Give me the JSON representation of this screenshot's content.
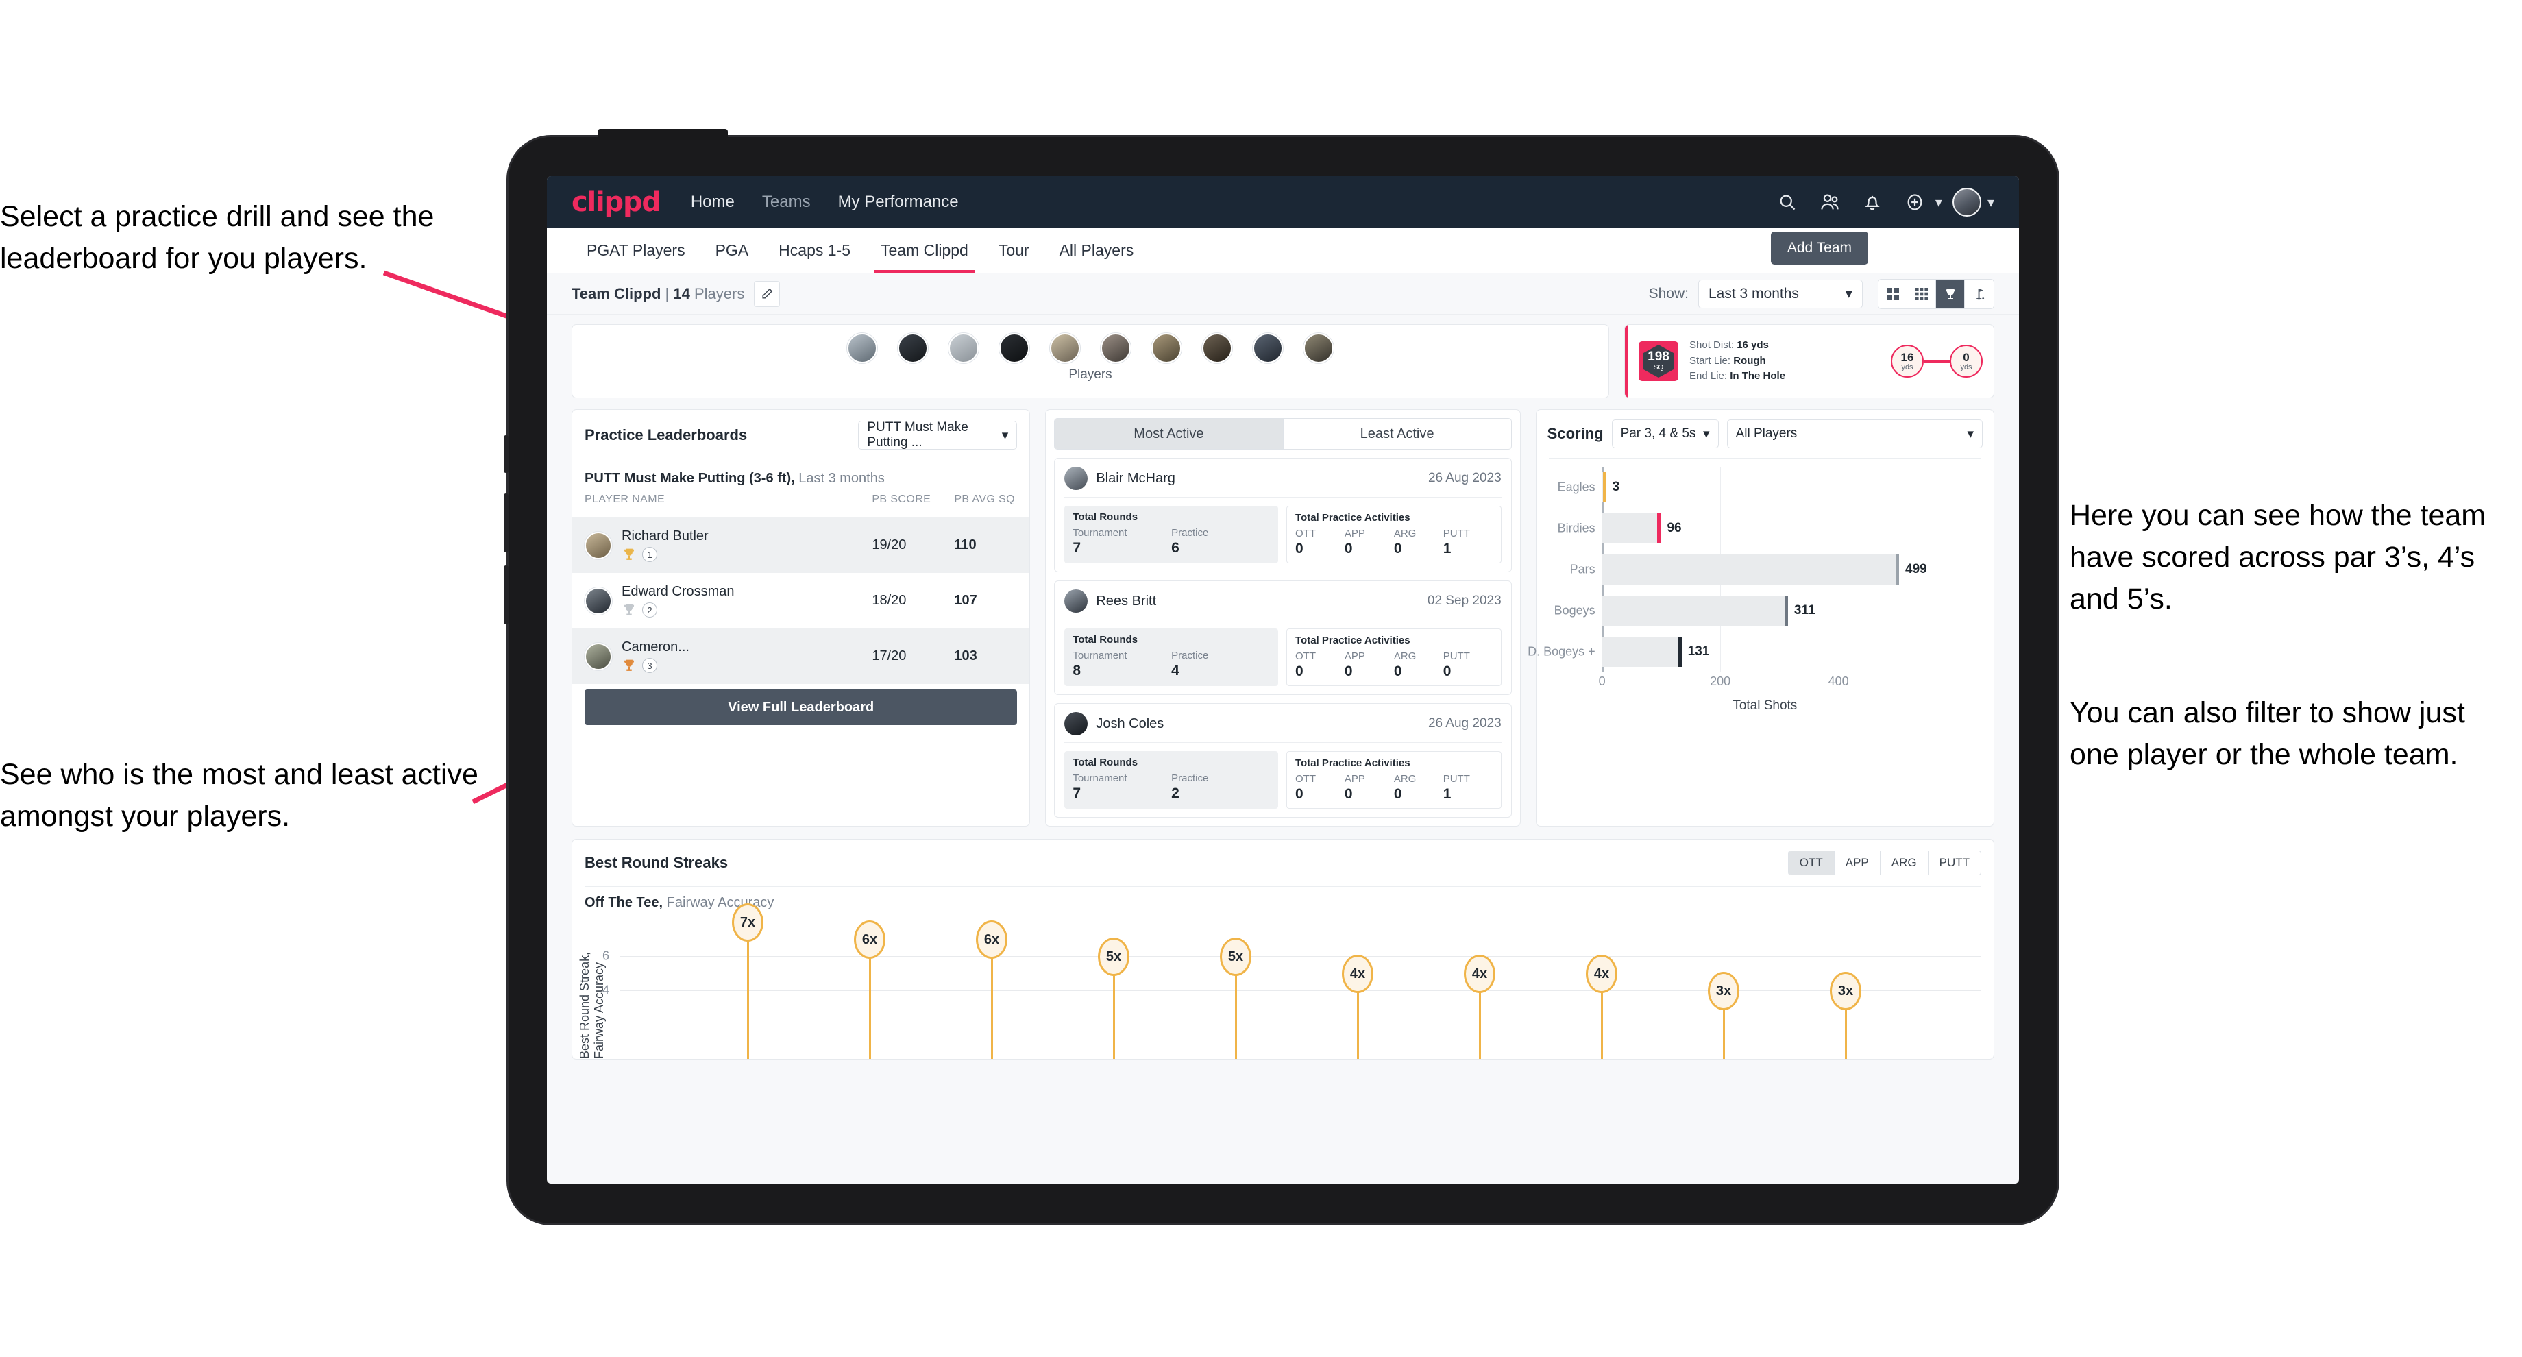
{
  "annotations": {
    "top_left": "Select a practice drill and see the leaderboard for you players.",
    "mid_left": "See who is the most and least active amongst your players.",
    "right_1": "Here you can see how the team have scored across par 3’s, 4’s and 5’s.",
    "right_2": "You can also filter to show just one player or the whole team."
  },
  "appbar": {
    "logo": "clippd",
    "links": [
      "Home",
      "Teams",
      "My Performance"
    ],
    "icons": [
      "search-icon",
      "people-icon",
      "bell-icon",
      "plus-circle-icon",
      "avatar"
    ]
  },
  "tabs": {
    "items": [
      "PGAT Players",
      "PGA",
      "Hcaps 1-5",
      "Team Clippd",
      "Tour",
      "All Players"
    ],
    "active": "Team Clippd",
    "add_team": "Add Team"
  },
  "toolbar": {
    "team_name": "Team Clippd",
    "separator": "|",
    "player_count": "14",
    "players_word": "Players",
    "show_label": "Show:",
    "show_value": "Last 3 months",
    "view_icons": [
      "grid-large-icon",
      "grid-small-icon",
      "trophy-icon",
      "flag-icon"
    ],
    "active_view": "trophy-icon"
  },
  "players_card": {
    "label": "Players",
    "avatar_count": 10
  },
  "shot_card": {
    "sq_value": "198",
    "sq_unit": "SQ",
    "lines": [
      {
        "key": "Shot Dist:",
        "value": "16 yds"
      },
      {
        "key": "Start Lie:",
        "value": "Rough"
      },
      {
        "key": "End Lie:",
        "value": "In The Hole"
      }
    ],
    "start_dist": {
      "value": "16",
      "unit": "yds"
    },
    "end_dist": {
      "value": "0",
      "unit": "yds"
    }
  },
  "leaderboard": {
    "title": "Practice Leaderboards",
    "drill_select": "PUTT Must Make Putting ...",
    "subtitle_bold": "PUTT Must Make Putting (3-6 ft),",
    "subtitle_rest": "Last 3 months",
    "columns": [
      "PLAYER NAME",
      "PB SCORE",
      "PB AVG SQ"
    ],
    "rows": [
      {
        "name": "Richard Butler",
        "rank": "1",
        "pb_score": "19/20",
        "pb_avg_sq": "110",
        "trophy": "gold"
      },
      {
        "name": "Edward Crossman",
        "rank": "2",
        "pb_score": "18/20",
        "pb_avg_sq": "107",
        "trophy": "silver"
      },
      {
        "name": "Cameron...",
        "rank": "3",
        "pb_score": "17/20",
        "pb_avg_sq": "103",
        "trophy": "bronze"
      }
    ],
    "view_full": "View Full Leaderboard"
  },
  "activity": {
    "tabs": [
      "Most Active",
      "Least Active"
    ],
    "active_tab": "Most Active",
    "rounds_title": "Total Rounds",
    "rounds_keys": [
      "Tournament",
      "Practice"
    ],
    "practice_title": "Total Practice Activities",
    "practice_keys": [
      "OTT",
      "APP",
      "ARG",
      "PUTT"
    ],
    "players": [
      {
        "name": "Blair McHarg",
        "date": "26 Aug 2023",
        "tournament": "7",
        "practice": "6",
        "ott": "0",
        "app": "0",
        "arg": "0",
        "putt": "1"
      },
      {
        "name": "Rees Britt",
        "date": "02 Sep 2023",
        "tournament": "8",
        "practice": "4",
        "ott": "0",
        "app": "0",
        "arg": "0",
        "putt": "0"
      },
      {
        "name": "Josh Coles",
        "date": "26 Aug 2023",
        "tournament": "7",
        "practice": "2",
        "ott": "0",
        "app": "0",
        "arg": "0",
        "putt": "1"
      }
    ]
  },
  "scoring": {
    "title": "Scoring",
    "par_select": "Par 3, 4 & 5s",
    "player_select": "All Players"
  },
  "streaks": {
    "title": "Best Round Streaks",
    "segments": [
      "OTT",
      "APP",
      "ARG",
      "PUTT"
    ],
    "active_segment": "OTT",
    "subtitle_bold": "Off The Tee,",
    "subtitle_rest": "Fairway Accuracy"
  },
  "chart_data": [
    {
      "type": "bar",
      "orientation": "horizontal",
      "title": "Scoring",
      "categories": [
        "Eagles",
        "Birdies",
        "Pars",
        "Bogeys",
        "D. Bogeys +"
      ],
      "values": [
        3,
        96,
        499,
        311,
        131
      ],
      "cap_colors": [
        "#f0b448",
        "#ee2a5e",
        "#9aa2aa",
        "#6e7782",
        "#222a33"
      ],
      "xlabel": "Total Shots",
      "ylabel": "",
      "xlim": [
        0,
        560
      ],
      "xticks": [
        0,
        200,
        400
      ],
      "grid": true,
      "legend": "none"
    },
    {
      "type": "bar",
      "orientation": "vertical",
      "title": "Best Round Streaks",
      "subtitle": "Off The Tee, Fairway Accuracy",
      "categories": [
        "",
        "",
        "",
        "",
        "",
        "",
        "",
        "",
        "",
        "",
        ""
      ],
      "values": [
        7,
        6,
        6,
        5,
        5,
        4,
        4,
        4,
        3,
        3
      ],
      "labels": [
        "7x",
        "6x",
        "6x",
        "5x",
        "5x",
        "4x",
        "4x",
        "4x",
        "3x",
        "3x"
      ],
      "ylabel": "Best Round Streak, Fairway Accuracy",
      "xlabel": "",
      "ylim": [
        0,
        8
      ],
      "yticks": [
        4,
        6
      ],
      "grid": true,
      "legend": "none"
    }
  ]
}
